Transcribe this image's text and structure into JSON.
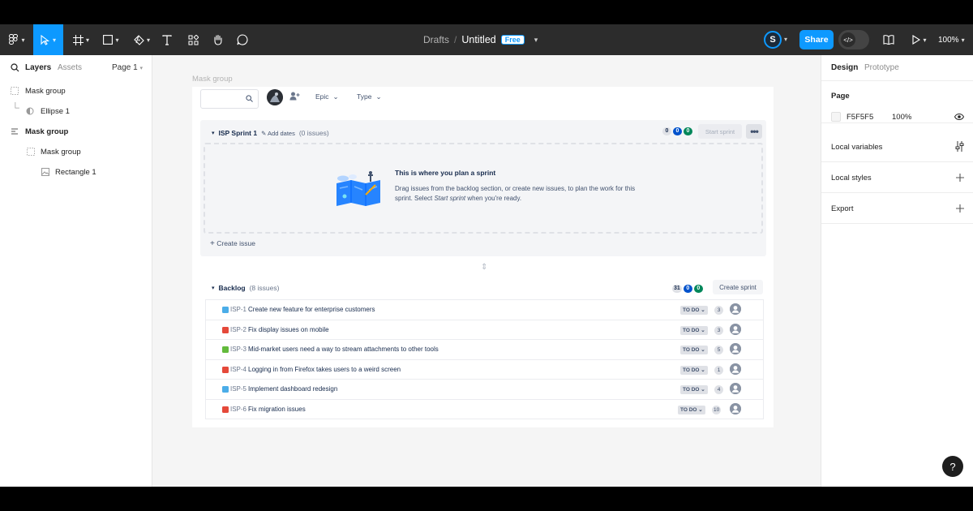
{
  "toolbar": {
    "breadcrumb_parent": "Drafts",
    "breadcrumb_sep": "/",
    "file_title": "Untitled",
    "plan_badge": "Free",
    "user_initial": "S",
    "share_label": "Share",
    "zoom": "100%",
    "icons": [
      "figma-menu-icon",
      "move-tool-icon",
      "frame-tool-icon",
      "shape-tool-icon",
      "pen-tool-icon",
      "text-tool-icon",
      "resources-icon",
      "hand-tool-icon",
      "comment-tool-icon",
      "library-icon",
      "present-icon"
    ]
  },
  "left_panel": {
    "tabs": {
      "layers": "Layers",
      "assets": "Assets",
      "page": "Page 1"
    },
    "layers": [
      {
        "label": "Mask group",
        "kind": "group"
      },
      {
        "label": "Ellipse 1",
        "kind": "ellipse"
      },
      {
        "label": "Mask group",
        "kind": "group"
      },
      {
        "label": "Mask group",
        "kind": "group"
      },
      {
        "label": "Rectangle 1",
        "kind": "rectangle"
      }
    ]
  },
  "canvas": {
    "frame_label": "Mask group",
    "filters": {
      "epic": "Epic",
      "type": "Type"
    },
    "sprint": {
      "name": "ISP Sprint 1",
      "add_dates": "Add dates",
      "issue_count": "(0 issues)",
      "pills": [
        "0",
        "0",
        "0"
      ],
      "start_label": "Start sprint",
      "more_label": "•••",
      "empty_title": "This is where you plan a sprint",
      "empty_body_1": "Drag issues from the backlog section, or create new issues, to plan the work for this sprint. Select ",
      "empty_body_em": "Start sprint",
      "empty_body_2": " when you're ready.",
      "create_issue": "Create issue"
    },
    "backlog": {
      "name": "Backlog",
      "issue_count": "(8 issues)",
      "pills": [
        "31",
        "0",
        "0"
      ],
      "create_sprint": "Create sprint",
      "issues": [
        {
          "key": "ISP-1",
          "summary": "Create new feature for enterprise customers",
          "type": "task",
          "type_color": "#4bade8",
          "status": "TO DO",
          "points": "3"
        },
        {
          "key": "ISP-2",
          "summary": "Fix display issues on mobile",
          "type": "bug",
          "type_color": "#e5493a",
          "status": "TO DO",
          "points": "3"
        },
        {
          "key": "ISP-3",
          "summary": "Mid-market users need a way to stream attachments to other tools",
          "type": "story",
          "type_color": "#63ba3c",
          "status": "TO DO",
          "points": "5"
        },
        {
          "key": "ISP-4",
          "summary": "Logging in from Firefox takes users to a weird screen",
          "type": "bug",
          "type_color": "#e5493a",
          "status": "TO DO",
          "points": "1"
        },
        {
          "key": "ISP-5",
          "summary": "Implement dashboard redesign",
          "type": "task",
          "type_color": "#4bade8",
          "status": "TO DO",
          "points": "4"
        },
        {
          "key": "ISP-6",
          "summary": "Fix migration issues",
          "type": "bug",
          "type_color": "#e5493a",
          "status": "TO DO",
          "points": "10"
        }
      ]
    }
  },
  "right_panel": {
    "tabs": {
      "design": "Design",
      "prototype": "Prototype"
    },
    "page": {
      "title": "Page",
      "color": "F5F5F5",
      "opacity": "100%"
    },
    "local_variables": "Local variables",
    "local_styles": "Local styles",
    "export": "Export"
  },
  "help_label": "?",
  "colors": {
    "accent": "#0d99ff",
    "toolbar": "#2c2c2c",
    "canvas": "#f5f5f5",
    "jira_blue": "#0052cc",
    "jira_green": "#00875a"
  }
}
